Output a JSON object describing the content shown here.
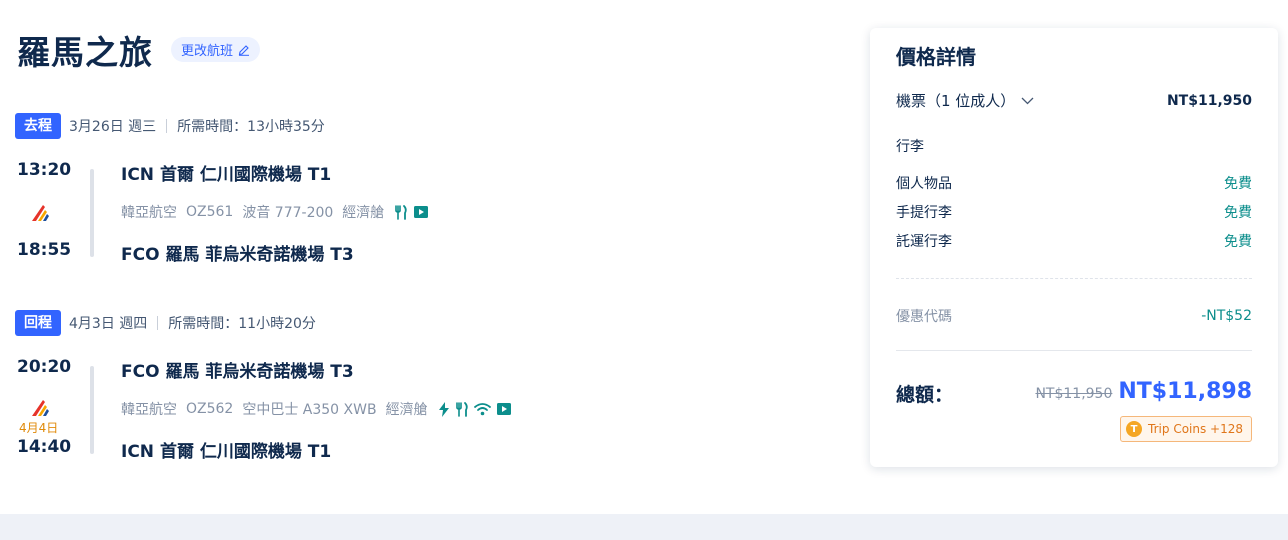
{
  "header": {
    "title": "羅馬之旅",
    "change_flight_label": "更改航班"
  },
  "segments": [
    {
      "tag": "去程",
      "date": "3月26日 週三",
      "duration": "所需時間：13小時35分",
      "depart_time": "13:20",
      "arrive_time": "18:55",
      "next_day": "",
      "from_airport": "ICN 首爾 仁川國際機場 T1",
      "to_airport": "FCO 羅馬 菲烏米奇諾機場 T3",
      "airline": "韓亞航空",
      "flight_no": "OZ561",
      "aircraft": "波音 777-200",
      "cabin": "經濟艙",
      "amenities": [
        "meal-icon",
        "entertainment-icon"
      ]
    },
    {
      "tag": "回程",
      "date": "4月3日 週四",
      "duration": "所需時間：11小時20分",
      "depart_time": "20:20",
      "arrive_time": "14:40",
      "next_day": "4月4日",
      "from_airport": "FCO 羅馬 菲烏米奇諾機場 T3",
      "to_airport": "ICN 首爾 仁川國際機場 T1",
      "airline": "韓亞航空",
      "flight_no": "OZ562",
      "aircraft": "空中巴士 A350 XWB",
      "cabin": "經濟艙",
      "amenities": [
        "power-icon",
        "meal-icon",
        "wifi-icon",
        "entertainment-icon"
      ]
    }
  ],
  "price": {
    "title": "價格詳情",
    "ticket_label": "機票（1 位成人）",
    "ticket_value": "NT$11,950",
    "baggage_heading": "行李",
    "baggage": [
      {
        "label": "個人物品",
        "value": "免費"
      },
      {
        "label": "手提行李",
        "value": "免費"
      },
      {
        "label": "託運行李",
        "value": "免費"
      }
    ],
    "promo_label": "優惠代碼",
    "promo_value": "-NT$52",
    "total_label": "總額：",
    "original_total": "NT$11,950",
    "total": "NT$11,898",
    "coins_label": "Trip Coins +128",
    "coin_symbol": "T"
  },
  "colors": {
    "primary": "#3264ff",
    "text": "#0f294d",
    "muted": "#8592a6",
    "free": "#0c8e8c",
    "coin": "#f5a623"
  }
}
